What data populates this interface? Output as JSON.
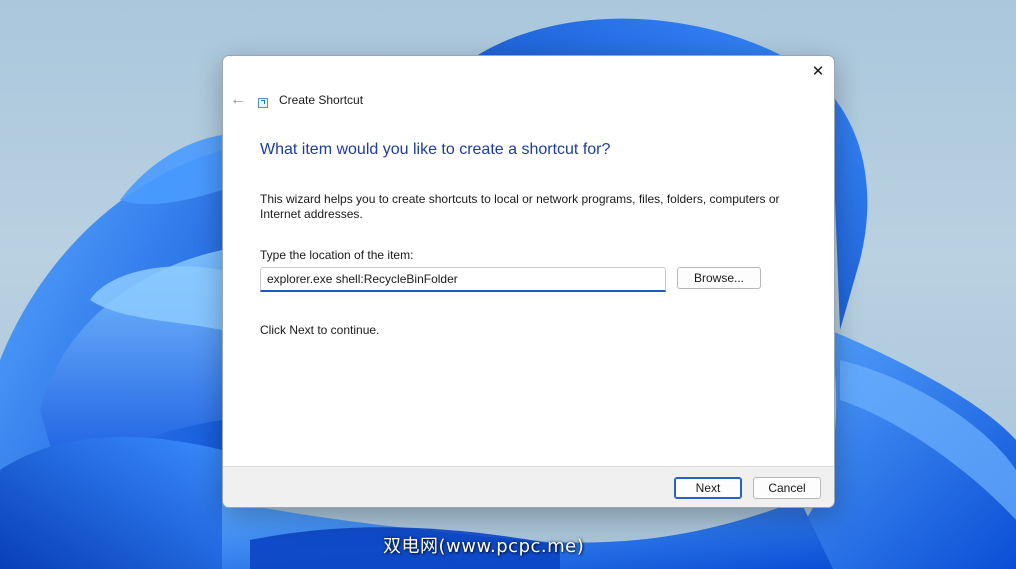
{
  "dialog": {
    "title": "Create Shortcut",
    "back_icon": "arrow-left-icon",
    "close_icon": "close-icon",
    "app_icon": "shortcut-icon",
    "close_glyph": "✕",
    "back_glyph": "←",
    "heading": "What item would you like to create a shortcut for?",
    "description": "This wizard helps you to create shortcuts to local or network programs, files, folders, computers or Internet addresses.",
    "location_label": "Type the location of the item:",
    "location_value": "explorer.exe shell:RecycleBinFolder",
    "browse_label": "Browse...",
    "continue_text": "Click Next to continue.",
    "next_label": "Next",
    "cancel_label": "Cancel"
  },
  "watermark": "双电网(www.pcpc.me)",
  "colors": {
    "heading": "#1f3d9a",
    "accent": "#2a62c4",
    "wallpaper_blue": "#1a6ff0"
  }
}
